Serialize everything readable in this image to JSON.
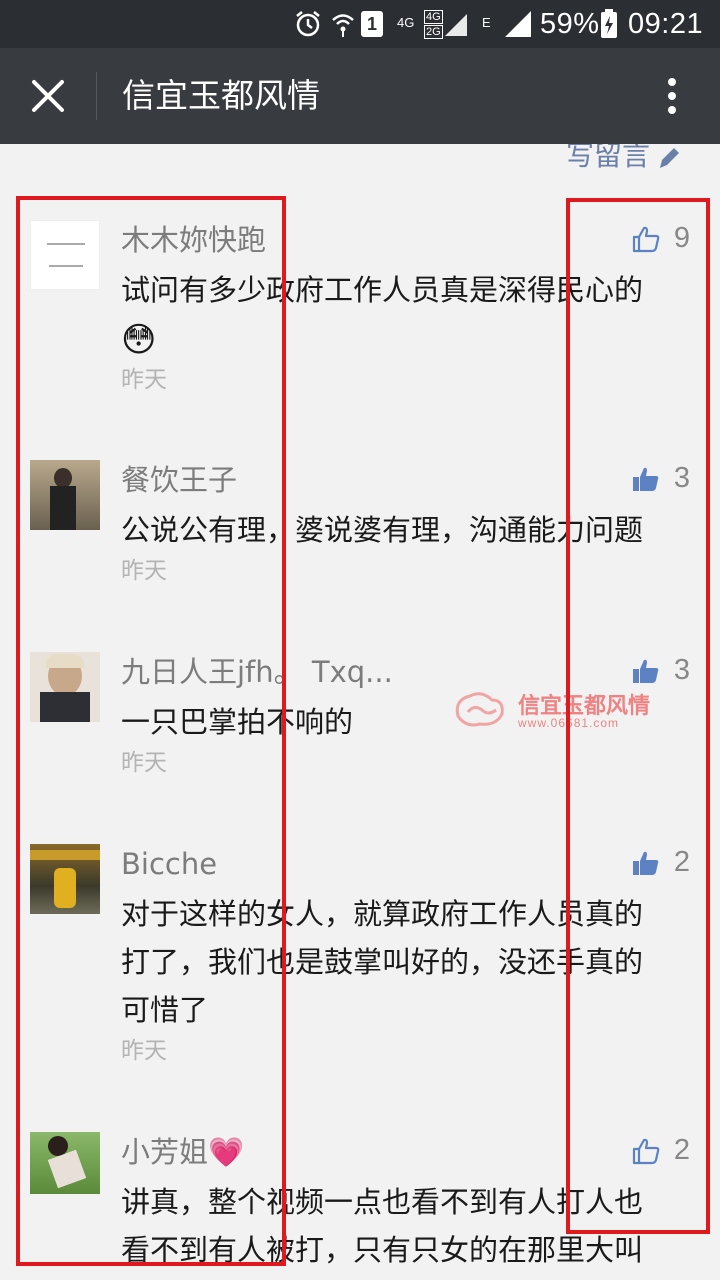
{
  "status_bar": {
    "network_4g": "4G",
    "network_4g_2g_top": "4G",
    "network_4g_2g_bottom": "2G",
    "network_e": "E",
    "battery": "59%",
    "time": "09:21",
    "sim_badge": "1"
  },
  "header": {
    "title": "信宜玉都风情"
  },
  "write_comment": {
    "label": "写留言"
  },
  "watermark": {
    "name": "信宜玉都风情",
    "url": "www.06681.com"
  },
  "comments": [
    {
      "nickname": "木木妳快跑",
      "text_lines": [
        "试问有多少政府工作人员真是深得民心的"
      ],
      "emoji": "😳",
      "time": "昨天",
      "likes": "9",
      "liked": false
    },
    {
      "nickname": "餐饮王子",
      "text_lines": [
        "公说公有理，婆说婆有理，沟通能力问题"
      ],
      "time": "昨天",
      "likes": "3",
      "liked": true
    },
    {
      "nickname": "九日人王jfh。 Txq...",
      "text_lines": [
        "一只巴掌拍不响的"
      ],
      "time": "昨天",
      "likes": "3",
      "liked": true
    },
    {
      "nickname": "Bicche",
      "text_lines": [
        "对于这样的女人，就算政府工作人员真的",
        "打了，我们也是鼓掌叫好的，没还手真的",
        "可惜了"
      ],
      "time": "昨天",
      "likes": "2",
      "liked": true
    },
    {
      "nickname": "小芳姐💗",
      "text_lines": [
        "讲真，整个视频一点也看不到有人打人也",
        "看不到有人被打，只有只女的在那里大叫"
      ],
      "likes": "2",
      "liked": false
    }
  ],
  "colors": {
    "status_bar_bg": "#2b2e33",
    "title_bar_bg": "#383b40",
    "page_bg": "#f2f2f2",
    "link_blue": "#6b80a8",
    "like_blue": "#5c82c4",
    "annotation_red": "#e0191f"
  }
}
